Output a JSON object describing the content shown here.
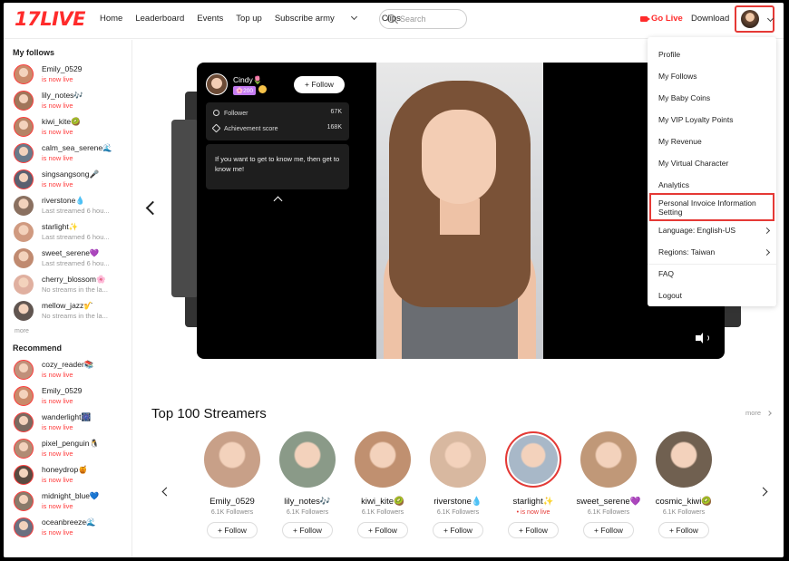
{
  "brand": {
    "logo": "17LIVE",
    "accent": "#ff2b2b"
  },
  "nav": {
    "home": "Home",
    "leaderboard": "Leaderboard",
    "events": "Events",
    "topup": "Top up",
    "subscribe": "Subscribe army",
    "clips": "Clips"
  },
  "search": {
    "placeholder": "Search"
  },
  "header_actions": {
    "golive": "Go Live",
    "download": "Download"
  },
  "sidebar": {
    "follows_title": "My follows",
    "follows": [
      {
        "name": "Emily_0529",
        "status": "is now live",
        "live": true,
        "color": "#c98a6a"
      },
      {
        "name": "lily_notes🎶",
        "status": "is now live",
        "live": true,
        "color": "#a0765a"
      },
      {
        "name": "kiwi_kite🥝",
        "status": "is now live",
        "live": true,
        "color": "#b58466"
      },
      {
        "name": "calm_sea_serene🌊",
        "status": "is now live",
        "live": true,
        "color": "#6a7a8a"
      },
      {
        "name": "singsangsong🎤",
        "status": "is now live",
        "live": true,
        "color": "#5a6070"
      },
      {
        "name": "riverstone💧",
        "status": "Last streamed 6 hou...",
        "live": false,
        "color": "#8a7060"
      },
      {
        "name": "starlight✨",
        "status": "Last streamed 6 hou...",
        "live": false,
        "color": "#d09a80"
      },
      {
        "name": "sweet_serene💜",
        "status": "Last streamed 6 hou...",
        "live": false,
        "color": "#c08a70"
      },
      {
        "name": "cherry_blossom🌸",
        "status": "No streams in the la...",
        "live": false,
        "color": "#e0b0a0"
      },
      {
        "name": "mellow_jazz🎷",
        "status": "No streams in the la...",
        "live": false,
        "color": "#605550"
      }
    ],
    "more": "more",
    "recommend_title": "Recommend",
    "recommend": [
      {
        "name": "cozy_reader📚",
        "status": "is now live",
        "live": true,
        "color": "#c0907a"
      },
      {
        "name": "Emily_0529",
        "status": "is now live",
        "live": true,
        "color": "#c98a6a"
      },
      {
        "name": "wanderlight🎆",
        "status": "is now live",
        "live": true,
        "color": "#7a6a60"
      },
      {
        "name": "pixel_penguin🐧",
        "status": "is now live",
        "live": true,
        "color": "#b08c74"
      },
      {
        "name": "honeydrop🍯",
        "status": "is now live",
        "live": true,
        "color": "#5a4a40"
      },
      {
        "name": "midnight_blue💙",
        "status": "is now live",
        "live": true,
        "color": "#8a7a6a"
      },
      {
        "name": "oceanbreeze🌊",
        "status": "is now live",
        "live": true,
        "color": "#6a7080"
      }
    ]
  },
  "hero": {
    "name": "Cindy🌷",
    "badge": "🌸200",
    "follow": "+ Follow",
    "follower_label": "Follower",
    "follower_value": "67K",
    "achievement_label": "Achievement score",
    "achievement_value": "168K",
    "bio": "If you want to get to know me, then get to know me!"
  },
  "top100": {
    "title": "Top 100 Streamers",
    "more": "more",
    "streamers": [
      {
        "name": "Emily_0529",
        "followers": "6.1K Followers",
        "follow": "+ Follow",
        "live": false,
        "color": "#c8a088"
      },
      {
        "name": "lily_notes🎶",
        "followers": "6.1K Followers",
        "follow": "+ Follow",
        "live": false,
        "color": "#8a9a88"
      },
      {
        "name": "kiwi_kite🥝",
        "followers": "6.1K Followers",
        "follow": "+ Follow",
        "live": false,
        "color": "#c09070"
      },
      {
        "name": "riverstone💧",
        "followers": "6.1K Followers",
        "follow": "+ Follow",
        "live": false,
        "color": "#d8b8a0"
      },
      {
        "name": "starlight✨",
        "followers": "• is now live",
        "follow": "+ Follow",
        "live": true,
        "color": "#a8b8c8"
      },
      {
        "name": "sweet_serene💜",
        "followers": "6.1K Followers",
        "follow": "+ Follow",
        "live": false,
        "color": "#c09878"
      },
      {
        "name": "cosmic_kiwi🥝",
        "followers": "6.1K Followers",
        "follow": "+ Follow",
        "live": false,
        "color": "#706050"
      }
    ]
  },
  "menu": {
    "profile": "Profile",
    "follows": "My Follows",
    "coins": "My Baby Coins",
    "vip": "My VIP Loyalty Points",
    "revenue": "My Revenue",
    "virtual": "My Virtual Character",
    "analytics": "Analytics",
    "invoice": "Personal Invoice Information Setting",
    "language": "Language:  English-US",
    "regions": "Regions:  Taiwan",
    "faq": "FAQ",
    "logout": "Logout"
  }
}
